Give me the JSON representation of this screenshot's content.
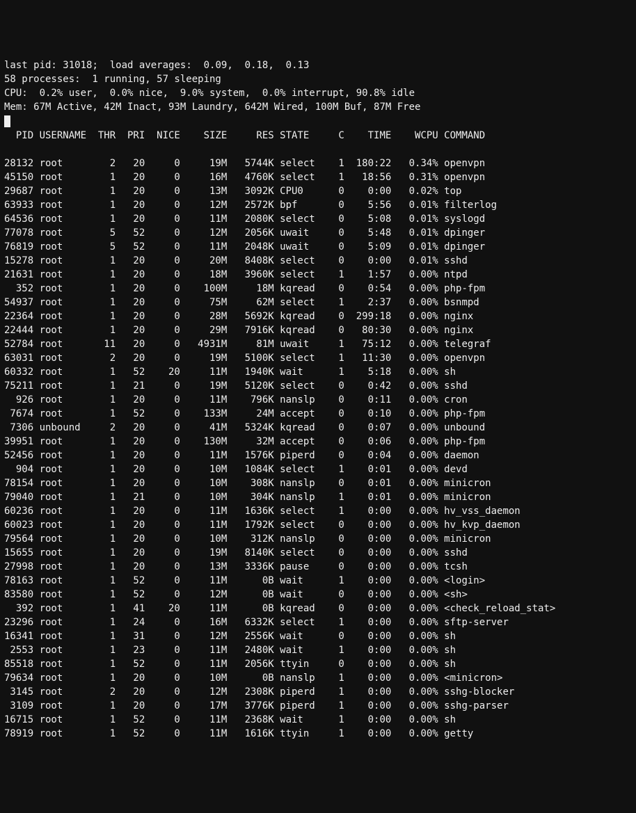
{
  "header": {
    "lastpid_label": "last pid:",
    "lastpid": "31018",
    "load_label": "load averages:",
    "loads": [
      "0.09",
      "0.18",
      "0.13"
    ],
    "proc_line": "58 processes:  1 running, 57 sleeping",
    "cpu_line": "CPU:  0.2% user,  0.0% nice,  9.0% system,  0.0% interrupt, 90.8% idle",
    "mem_line": "Mem: 67M Active, 42M Inact, 93M Laundry, 642M Wired, 100M Buf, 87M Free"
  },
  "columns": [
    "PID",
    "USERNAME",
    "THR",
    "PRI",
    "NICE",
    "SIZE",
    "RES",
    "STATE",
    "C",
    "TIME",
    "WCPU",
    "COMMAND"
  ],
  "processes": [
    {
      "pid": "28132",
      "user": "root",
      "thr": "2",
      "pri": "20",
      "nice": "0",
      "size": "19M",
      "res": "5744K",
      "state": "select",
      "c": "1",
      "time": "180:22",
      "wcpu": "0.34%",
      "cmd": "openvpn"
    },
    {
      "pid": "45150",
      "user": "root",
      "thr": "1",
      "pri": "20",
      "nice": "0",
      "size": "16M",
      "res": "4760K",
      "state": "select",
      "c": "1",
      "time": "18:56",
      "wcpu": "0.31%",
      "cmd": "openvpn"
    },
    {
      "pid": "29687",
      "user": "root",
      "thr": "1",
      "pri": "20",
      "nice": "0",
      "size": "13M",
      "res": "3092K",
      "state": "CPU0",
      "c": "0",
      "time": "0:00",
      "wcpu": "0.02%",
      "cmd": "top"
    },
    {
      "pid": "63933",
      "user": "root",
      "thr": "1",
      "pri": "20",
      "nice": "0",
      "size": "12M",
      "res": "2572K",
      "state": "bpf",
      "c": "0",
      "time": "5:56",
      "wcpu": "0.01%",
      "cmd": "filterlog"
    },
    {
      "pid": "64536",
      "user": "root",
      "thr": "1",
      "pri": "20",
      "nice": "0",
      "size": "11M",
      "res": "2080K",
      "state": "select",
      "c": "0",
      "time": "5:08",
      "wcpu": "0.01%",
      "cmd": "syslogd"
    },
    {
      "pid": "77078",
      "user": "root",
      "thr": "5",
      "pri": "52",
      "nice": "0",
      "size": "12M",
      "res": "2056K",
      "state": "uwait",
      "c": "0",
      "time": "5:48",
      "wcpu": "0.01%",
      "cmd": "dpinger"
    },
    {
      "pid": "76819",
      "user": "root",
      "thr": "5",
      "pri": "52",
      "nice": "0",
      "size": "11M",
      "res": "2048K",
      "state": "uwait",
      "c": "0",
      "time": "5:09",
      "wcpu": "0.01%",
      "cmd": "dpinger"
    },
    {
      "pid": "15278",
      "user": "root",
      "thr": "1",
      "pri": "20",
      "nice": "0",
      "size": "20M",
      "res": "8408K",
      "state": "select",
      "c": "0",
      "time": "0:00",
      "wcpu": "0.01%",
      "cmd": "sshd"
    },
    {
      "pid": "21631",
      "user": "root",
      "thr": "1",
      "pri": "20",
      "nice": "0",
      "size": "18M",
      "res": "3960K",
      "state": "select",
      "c": "1",
      "time": "1:57",
      "wcpu": "0.00%",
      "cmd": "ntpd"
    },
    {
      "pid": "352",
      "user": "root",
      "thr": "1",
      "pri": "20",
      "nice": "0",
      "size": "100M",
      "res": "18M",
      "state": "kqread",
      "c": "0",
      "time": "0:54",
      "wcpu": "0.00%",
      "cmd": "php-fpm"
    },
    {
      "pid": "54937",
      "user": "root",
      "thr": "1",
      "pri": "20",
      "nice": "0",
      "size": "75M",
      "res": "62M",
      "state": "select",
      "c": "1",
      "time": "2:37",
      "wcpu": "0.00%",
      "cmd": "bsnmpd"
    },
    {
      "pid": "22364",
      "user": "root",
      "thr": "1",
      "pri": "20",
      "nice": "0",
      "size": "28M",
      "res": "5692K",
      "state": "kqread",
      "c": "0",
      "time": "299:18",
      "wcpu": "0.00%",
      "cmd": "nginx"
    },
    {
      "pid": "22444",
      "user": "root",
      "thr": "1",
      "pri": "20",
      "nice": "0",
      "size": "29M",
      "res": "7916K",
      "state": "kqread",
      "c": "0",
      "time": "80:30",
      "wcpu": "0.00%",
      "cmd": "nginx"
    },
    {
      "pid": "52784",
      "user": "root",
      "thr": "11",
      "pri": "20",
      "nice": "0",
      "size": "4931M",
      "res": "81M",
      "state": "uwait",
      "c": "1",
      "time": "75:12",
      "wcpu": "0.00%",
      "cmd": "telegraf"
    },
    {
      "pid": "63031",
      "user": "root",
      "thr": "2",
      "pri": "20",
      "nice": "0",
      "size": "19M",
      "res": "5100K",
      "state": "select",
      "c": "1",
      "time": "11:30",
      "wcpu": "0.00%",
      "cmd": "openvpn"
    },
    {
      "pid": "60332",
      "user": "root",
      "thr": "1",
      "pri": "52",
      "nice": "20",
      "size": "11M",
      "res": "1940K",
      "state": "wait",
      "c": "1",
      "time": "5:18",
      "wcpu": "0.00%",
      "cmd": "sh"
    },
    {
      "pid": "75211",
      "user": "root",
      "thr": "1",
      "pri": "21",
      "nice": "0",
      "size": "19M",
      "res": "5120K",
      "state": "select",
      "c": "0",
      "time": "0:42",
      "wcpu": "0.00%",
      "cmd": "sshd"
    },
    {
      "pid": "926",
      "user": "root",
      "thr": "1",
      "pri": "20",
      "nice": "0",
      "size": "11M",
      "res": "796K",
      "state": "nanslp",
      "c": "0",
      "time": "0:11",
      "wcpu": "0.00%",
      "cmd": "cron"
    },
    {
      "pid": "7674",
      "user": "root",
      "thr": "1",
      "pri": "52",
      "nice": "0",
      "size": "133M",
      "res": "24M",
      "state": "accept",
      "c": "0",
      "time": "0:10",
      "wcpu": "0.00%",
      "cmd": "php-fpm"
    },
    {
      "pid": "7306",
      "user": "unbound",
      "thr": "2",
      "pri": "20",
      "nice": "0",
      "size": "41M",
      "res": "5324K",
      "state": "kqread",
      "c": "0",
      "time": "0:07",
      "wcpu": "0.00%",
      "cmd": "unbound"
    },
    {
      "pid": "39951",
      "user": "root",
      "thr": "1",
      "pri": "20",
      "nice": "0",
      "size": "130M",
      "res": "32M",
      "state": "accept",
      "c": "0",
      "time": "0:06",
      "wcpu": "0.00%",
      "cmd": "php-fpm"
    },
    {
      "pid": "52456",
      "user": "root",
      "thr": "1",
      "pri": "20",
      "nice": "0",
      "size": "11M",
      "res": "1576K",
      "state": "piperd",
      "c": "0",
      "time": "0:04",
      "wcpu": "0.00%",
      "cmd": "daemon"
    },
    {
      "pid": "904",
      "user": "root",
      "thr": "1",
      "pri": "20",
      "nice": "0",
      "size": "10M",
      "res": "1084K",
      "state": "select",
      "c": "1",
      "time": "0:01",
      "wcpu": "0.00%",
      "cmd": "devd"
    },
    {
      "pid": "78154",
      "user": "root",
      "thr": "1",
      "pri": "20",
      "nice": "0",
      "size": "10M",
      "res": "308K",
      "state": "nanslp",
      "c": "0",
      "time": "0:01",
      "wcpu": "0.00%",
      "cmd": "minicron"
    },
    {
      "pid": "79040",
      "user": "root",
      "thr": "1",
      "pri": "21",
      "nice": "0",
      "size": "10M",
      "res": "304K",
      "state": "nanslp",
      "c": "1",
      "time": "0:01",
      "wcpu": "0.00%",
      "cmd": "minicron"
    },
    {
      "pid": "60236",
      "user": "root",
      "thr": "1",
      "pri": "20",
      "nice": "0",
      "size": "11M",
      "res": "1636K",
      "state": "select",
      "c": "1",
      "time": "0:00",
      "wcpu": "0.00%",
      "cmd": "hv_vss_daemon"
    },
    {
      "pid": "60023",
      "user": "root",
      "thr": "1",
      "pri": "20",
      "nice": "0",
      "size": "11M",
      "res": "1792K",
      "state": "select",
      "c": "0",
      "time": "0:00",
      "wcpu": "0.00%",
      "cmd": "hv_kvp_daemon"
    },
    {
      "pid": "79564",
      "user": "root",
      "thr": "1",
      "pri": "20",
      "nice": "0",
      "size": "10M",
      "res": "312K",
      "state": "nanslp",
      "c": "0",
      "time": "0:00",
      "wcpu": "0.00%",
      "cmd": "minicron"
    },
    {
      "pid": "15655",
      "user": "root",
      "thr": "1",
      "pri": "20",
      "nice": "0",
      "size": "19M",
      "res": "8140K",
      "state": "select",
      "c": "0",
      "time": "0:00",
      "wcpu": "0.00%",
      "cmd": "sshd"
    },
    {
      "pid": "27998",
      "user": "root",
      "thr": "1",
      "pri": "20",
      "nice": "0",
      "size": "13M",
      "res": "3336K",
      "state": "pause",
      "c": "0",
      "time": "0:00",
      "wcpu": "0.00%",
      "cmd": "tcsh"
    },
    {
      "pid": "78163",
      "user": "root",
      "thr": "1",
      "pri": "52",
      "nice": "0",
      "size": "11M",
      "res": "0B",
      "state": "wait",
      "c": "1",
      "time": "0:00",
      "wcpu": "0.00%",
      "cmd": "<login>"
    },
    {
      "pid": "83580",
      "user": "root",
      "thr": "1",
      "pri": "52",
      "nice": "0",
      "size": "12M",
      "res": "0B",
      "state": "wait",
      "c": "0",
      "time": "0:00",
      "wcpu": "0.00%",
      "cmd": "<sh>"
    },
    {
      "pid": "392",
      "user": "root",
      "thr": "1",
      "pri": "41",
      "nice": "20",
      "size": "11M",
      "res": "0B",
      "state": "kqread",
      "c": "0",
      "time": "0:00",
      "wcpu": "0.00%",
      "cmd": "<check_reload_stat>"
    },
    {
      "pid": "23296",
      "user": "root",
      "thr": "1",
      "pri": "24",
      "nice": "0",
      "size": "16M",
      "res": "6332K",
      "state": "select",
      "c": "1",
      "time": "0:00",
      "wcpu": "0.00%",
      "cmd": "sftp-server"
    },
    {
      "pid": "16341",
      "user": "root",
      "thr": "1",
      "pri": "31",
      "nice": "0",
      "size": "12M",
      "res": "2556K",
      "state": "wait",
      "c": "0",
      "time": "0:00",
      "wcpu": "0.00%",
      "cmd": "sh"
    },
    {
      "pid": "2553",
      "user": "root",
      "thr": "1",
      "pri": "23",
      "nice": "0",
      "size": "11M",
      "res": "2480K",
      "state": "wait",
      "c": "1",
      "time": "0:00",
      "wcpu": "0.00%",
      "cmd": "sh"
    },
    {
      "pid": "85518",
      "user": "root",
      "thr": "1",
      "pri": "52",
      "nice": "0",
      "size": "11M",
      "res": "2056K",
      "state": "ttyin",
      "c": "0",
      "time": "0:00",
      "wcpu": "0.00%",
      "cmd": "sh"
    },
    {
      "pid": "79634",
      "user": "root",
      "thr": "1",
      "pri": "20",
      "nice": "0",
      "size": "10M",
      "res": "0B",
      "state": "nanslp",
      "c": "1",
      "time": "0:00",
      "wcpu": "0.00%",
      "cmd": "<minicron>"
    },
    {
      "pid": "3145",
      "user": "root",
      "thr": "2",
      "pri": "20",
      "nice": "0",
      "size": "12M",
      "res": "2308K",
      "state": "piperd",
      "c": "1",
      "time": "0:00",
      "wcpu": "0.00%",
      "cmd": "sshg-blocker"
    },
    {
      "pid": "3109",
      "user": "root",
      "thr": "1",
      "pri": "20",
      "nice": "0",
      "size": "17M",
      "res": "3776K",
      "state": "piperd",
      "c": "1",
      "time": "0:00",
      "wcpu": "0.00%",
      "cmd": "sshg-parser"
    },
    {
      "pid": "16715",
      "user": "root",
      "thr": "1",
      "pri": "52",
      "nice": "0",
      "size": "11M",
      "res": "2368K",
      "state": "wait",
      "c": "1",
      "time": "0:00",
      "wcpu": "0.00%",
      "cmd": "sh"
    },
    {
      "pid": "78919",
      "user": "root",
      "thr": "1",
      "pri": "52",
      "nice": "0",
      "size": "11M",
      "res": "1616K",
      "state": "ttyin",
      "c": "1",
      "time": "0:00",
      "wcpu": "0.00%",
      "cmd": "getty"
    }
  ]
}
